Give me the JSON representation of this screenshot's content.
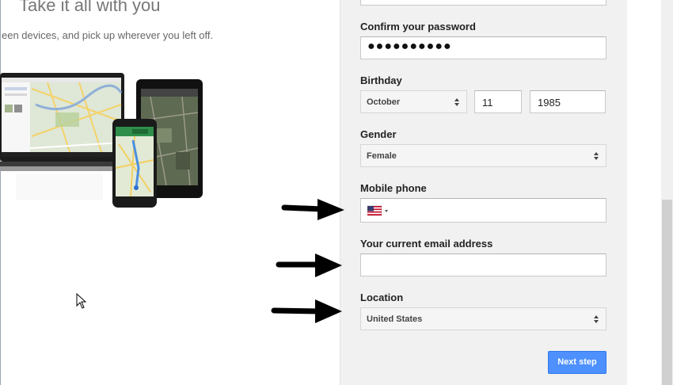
{
  "promo": {
    "title": "Take it all with you",
    "subtitle": "een devices, and pick up wherever you left off."
  },
  "form": {
    "confirm_password": {
      "label": "Confirm your password",
      "masked_value": "●●●●●●●●●●"
    },
    "birthday": {
      "label": "Birthday",
      "month": "October",
      "day": "11",
      "year": "1985"
    },
    "gender": {
      "label": "Gender",
      "value": "Female"
    },
    "mobile_phone": {
      "label": "Mobile phone",
      "country_flag": "us-flag-icon",
      "value": ""
    },
    "email": {
      "label": "Your current email address",
      "value": ""
    },
    "location": {
      "label": "Location",
      "value": "United States"
    },
    "next_button": "Next step"
  },
  "colors": {
    "panel_bg": "#f1f1f1",
    "primary_button": "#4d90fe",
    "annotation_arrow": "#000000"
  }
}
